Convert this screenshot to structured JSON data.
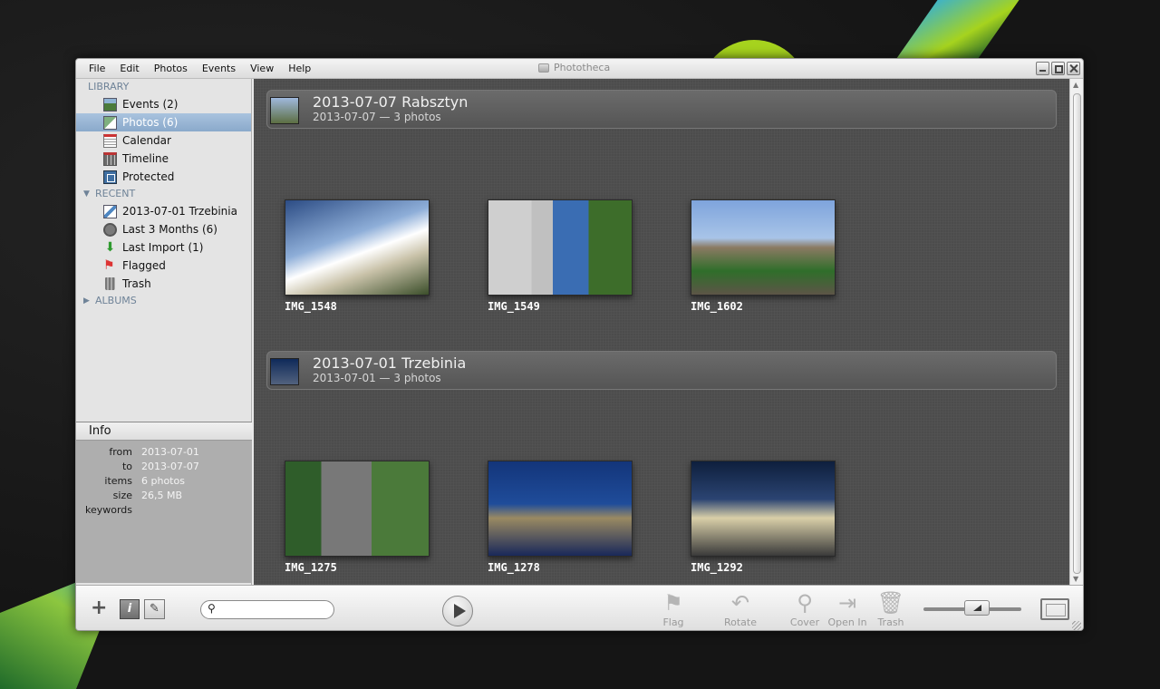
{
  "app": {
    "title": "Phototheca",
    "menu": [
      "File",
      "Edit",
      "Photos",
      "Events",
      "View",
      "Help"
    ]
  },
  "sidebar": {
    "library_header": "LIBRARY",
    "library_items": [
      {
        "label": "Events (2)",
        "icon": "events-icon"
      },
      {
        "label": "Photos (6)",
        "icon": "photos-icon",
        "selected": true
      },
      {
        "label": "Calendar",
        "icon": "calendar-icon"
      },
      {
        "label": "Timeline",
        "icon": "timeline-icon"
      },
      {
        "label": "Protected",
        "icon": "protected-icon"
      }
    ],
    "recent_header": "RECENT",
    "recent_items": [
      {
        "label": "2013-07-01 Trzebinia",
        "icon": "event-pencil-icon"
      },
      {
        "label": "Last 3 Months (6)",
        "icon": "clock-icon"
      },
      {
        "label": "Last Import (1)",
        "icon": "import-icon"
      },
      {
        "label": "Flagged",
        "icon": "flag-icon"
      },
      {
        "label": "Trash",
        "icon": "trash-icon"
      }
    ],
    "albums_header": "ALBUMS"
  },
  "info": {
    "title": "Info",
    "rows": [
      {
        "key": "from",
        "value": "2013-07-01"
      },
      {
        "key": "to",
        "value": "2013-07-07"
      },
      {
        "key": "items",
        "value": "6 photos"
      },
      {
        "key": "size",
        "value": "26,5 MB"
      },
      {
        "key": "keywords",
        "value": ""
      }
    ]
  },
  "events": [
    {
      "title": "2013-07-07 Rabsztyn",
      "subtitle": "2013-07-07 — 3 photos",
      "photos": [
        "IMG_1548",
        "IMG_1549",
        "IMG_1602"
      ]
    },
    {
      "title": "2013-07-01 Trzebinia",
      "subtitle": "2013-07-01 — 3 photos",
      "photos": [
        "IMG_1275",
        "IMG_1278",
        "IMG_1292"
      ]
    }
  ],
  "toolbar": {
    "search_placeholder": "",
    "actions": [
      {
        "label": "Flag",
        "icon": "flag-icon"
      },
      {
        "label": "Rotate",
        "icon": "rotate-icon"
      },
      {
        "label": "Cover",
        "icon": "pin-icon"
      },
      {
        "label": "Open In",
        "icon": "open-in-icon"
      },
      {
        "label": "Trash",
        "icon": "trash-icon"
      }
    ]
  },
  "colors": {
    "selection": "#8aa9cb",
    "content_bg": "#4c4c4c",
    "header_text": "#6f8398"
  }
}
